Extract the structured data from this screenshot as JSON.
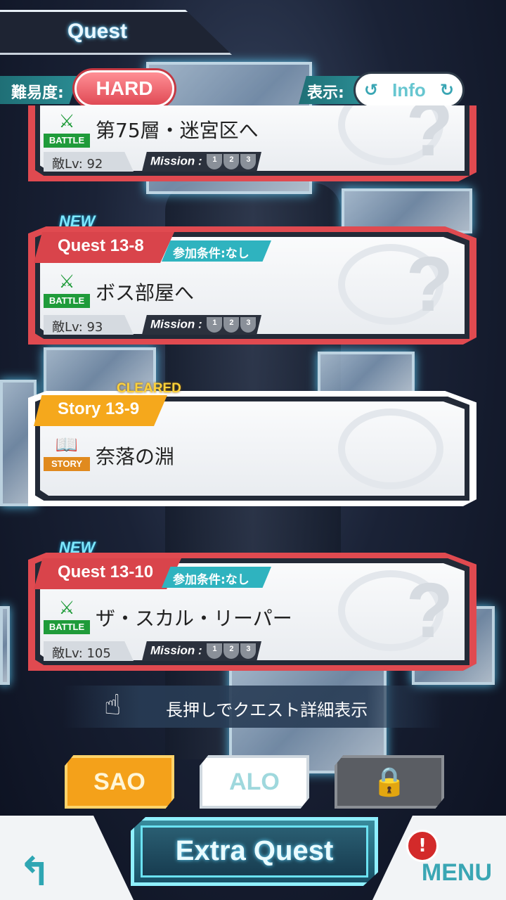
{
  "header": {
    "title": "Quest"
  },
  "difficulty": {
    "label": "難易度:",
    "value": "HARD"
  },
  "display": {
    "label": "表示:",
    "value": "Info"
  },
  "quests": [
    {
      "id": "",
      "type_label": "BATTLE",
      "name": "第75層・迷宮区へ",
      "level": "敵Lv: 92",
      "mission_label": "Mission :",
      "new": "",
      "condition": ""
    },
    {
      "id": "Quest 13-8",
      "type_label": "BATTLE",
      "name": "ボス部屋へ",
      "level": "敵Lv: 93",
      "mission_label": "Mission :",
      "new": "NEW",
      "condition": "参加条件:なし"
    },
    {
      "id": "Story 13-9",
      "type_label": "STORY",
      "name": "奈落の淵",
      "status": "CLEARED"
    },
    {
      "id": "Quest 13-10",
      "type_label": "BATTLE",
      "name": "ザ・スカル・リーパー",
      "level": "敵Lv: 105",
      "mission_label": "Mission :",
      "new": "NEW",
      "condition": "参加条件:なし"
    }
  ],
  "trophies": [
    "1",
    "2",
    "3"
  ],
  "hint": "長押しでクエスト詳細表示",
  "tabs": {
    "sao": "SAO",
    "alo": "ALO"
  },
  "footer": {
    "extra_quest": "Extra Quest",
    "menu": "MENU",
    "alert": "!"
  },
  "icons": {
    "difficulty": "pill-button",
    "display_left": "cycle-left-icon",
    "display_right": "cycle-right-icon",
    "battle": "sword-icon",
    "story": "book-icon",
    "hint": "clock-hand-icon",
    "lock": "lock-icon",
    "back": "back-arrow-icon"
  },
  "colors": {
    "accent_red": "#e04a50",
    "accent_teal": "#2fb3bf",
    "story_orange": "#f5a81c",
    "sao_orange": "#f4a11a"
  }
}
